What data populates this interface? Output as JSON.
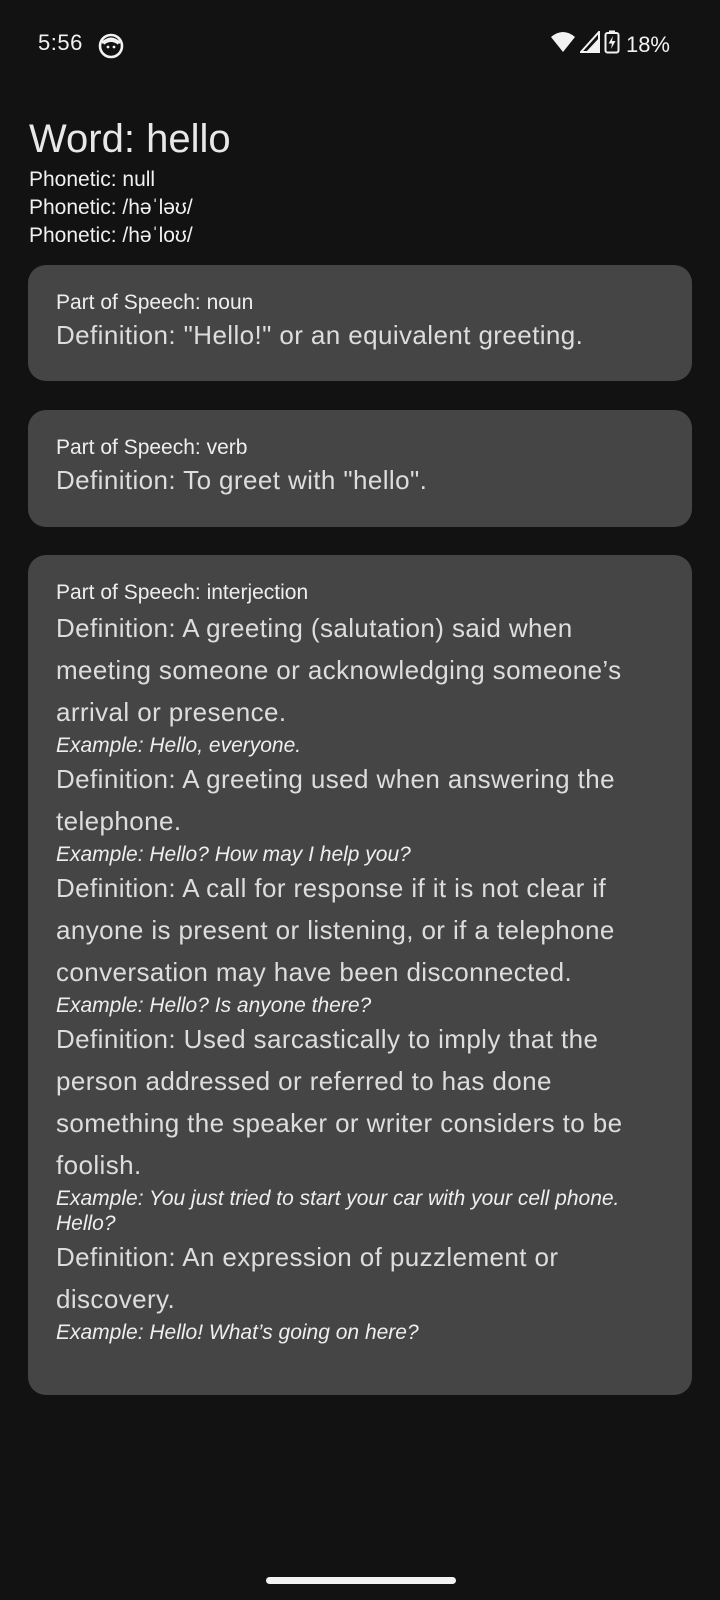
{
  "status_bar": {
    "time": "5:56",
    "battery": "18%",
    "icons": [
      "face-icon",
      "wifi-icon",
      "signal-icon",
      "battery-icon"
    ]
  },
  "word": {
    "title": "Word: hello",
    "phonetics": [
      "Phonetic: null",
      "Phonetic: /həˈləʊ/",
      "Phonetic: /həˈloʊ/"
    ]
  },
  "meanings": [
    {
      "part_of_speech": "Part of Speech: noun",
      "definitions": [
        {
          "definition": "Definition: \"Hello!\" or an equivalent greeting."
        }
      ]
    },
    {
      "part_of_speech": "Part of Speech: verb",
      "definitions": [
        {
          "definition": "Definition: To greet with \"hello\"."
        }
      ]
    },
    {
      "part_of_speech": "Part of Speech: interjection",
      "definitions": [
        {
          "definition": "Definition: A greeting (salutation) said when meeting someone or acknowledging someone’s arrival or presence.",
          "example": "Example: Hello, everyone."
        },
        {
          "definition": "Definition: A greeting used when answering the telephone.",
          "example": "Example: Hello? How may I help you?"
        },
        {
          "definition": "Definition: A call for response if it is not clear if anyone is present or listening, or if a telephone conversation may have been disconnected.",
          "example": "Example: Hello? Is anyone there?"
        },
        {
          "definition": "Definition: Used sarcastically to imply that the person addressed or referred to has done something the speaker or writer considers to be foolish.",
          "example": "Example: You just tried to start your car with your cell phone. Hello?"
        },
        {
          "definition": "Definition: An expression of puzzlement or discovery.",
          "example": "Example: Hello! What’s going on here?"
        }
      ]
    }
  ],
  "colors": {
    "background": "#121212",
    "card": "#454545",
    "text": "#e6e6e6"
  }
}
